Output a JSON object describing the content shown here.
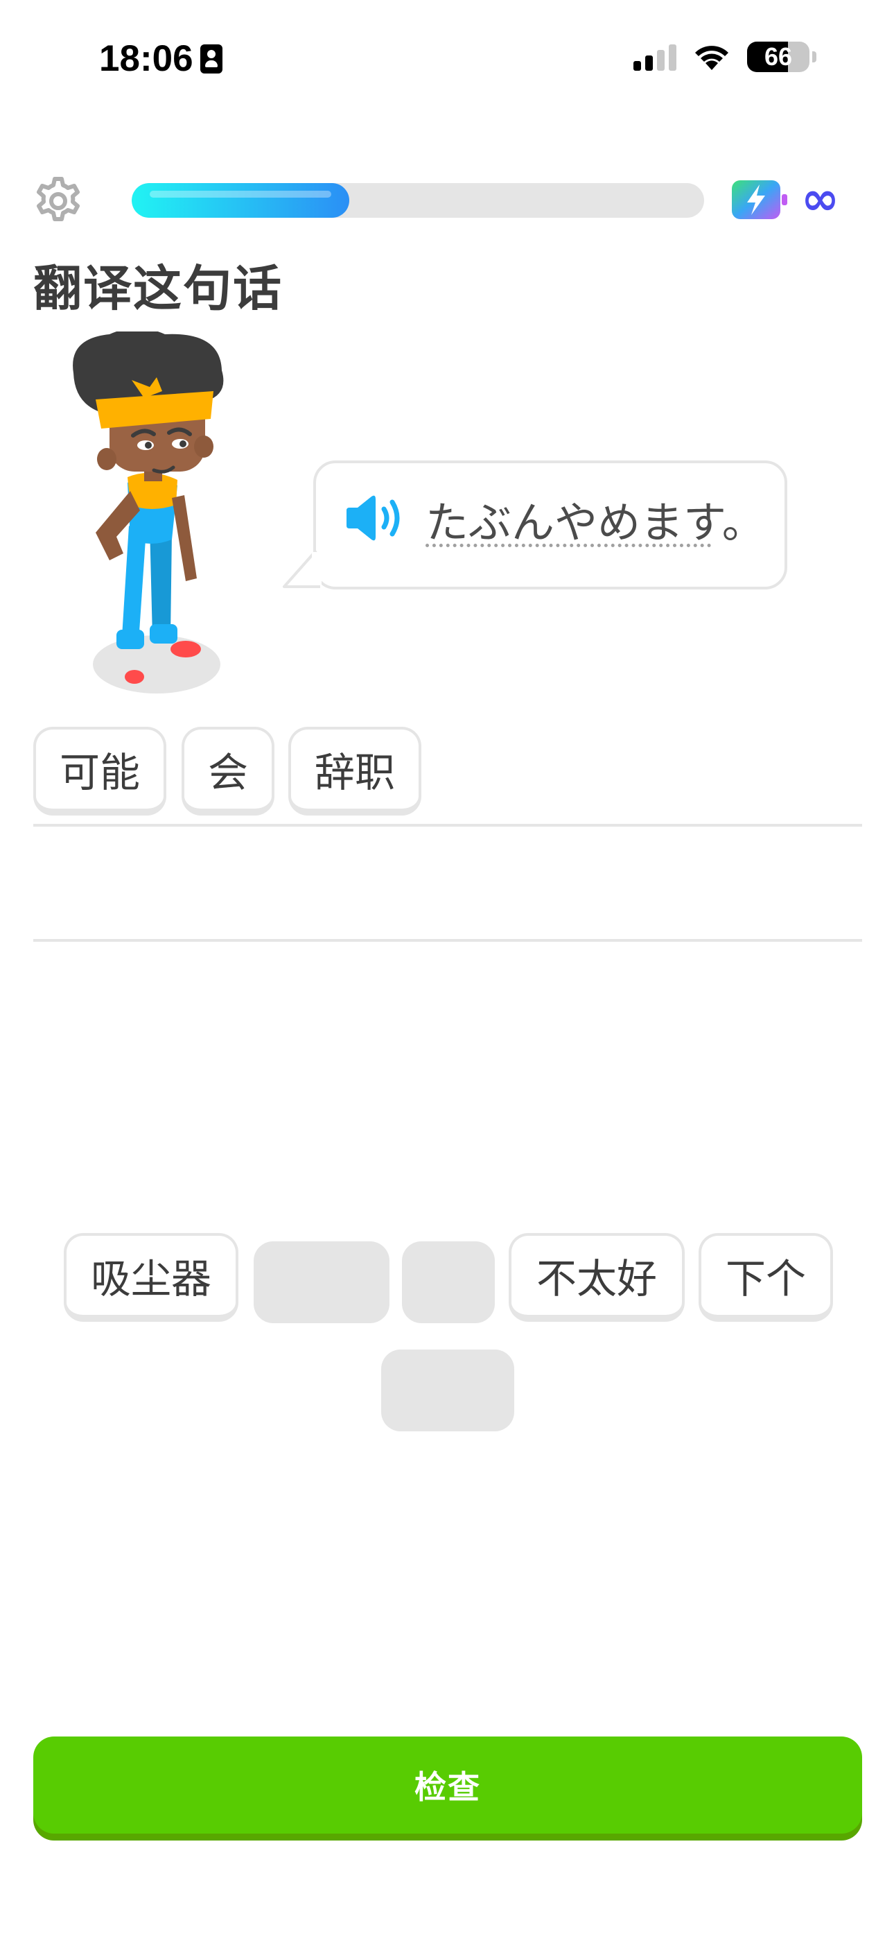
{
  "status_bar": {
    "time": "18:06",
    "battery": "66"
  },
  "header": {
    "progress_fraction": 0.38,
    "hearts": "∞"
  },
  "exercise": {
    "title": "翻译这句话",
    "prompt": "たぶんやめます。"
  },
  "answer_tokens": [
    "可能",
    "会",
    "辞职"
  ],
  "word_bank": [
    "吸尘器",
    "不太好",
    "下个"
  ],
  "check_button": {
    "label": "检查"
  },
  "colors": {
    "accent_green": "#58cc02",
    "accent_blue": "#1cb0f6",
    "border_gray": "#e5e5e5",
    "text_dark": "#3c3c3c"
  },
  "icons": [
    "id-card-icon",
    "signal-icon",
    "wifi-icon",
    "battery-icon",
    "gear-icon",
    "energy-icon",
    "infinity-icon",
    "speaker-icon"
  ]
}
